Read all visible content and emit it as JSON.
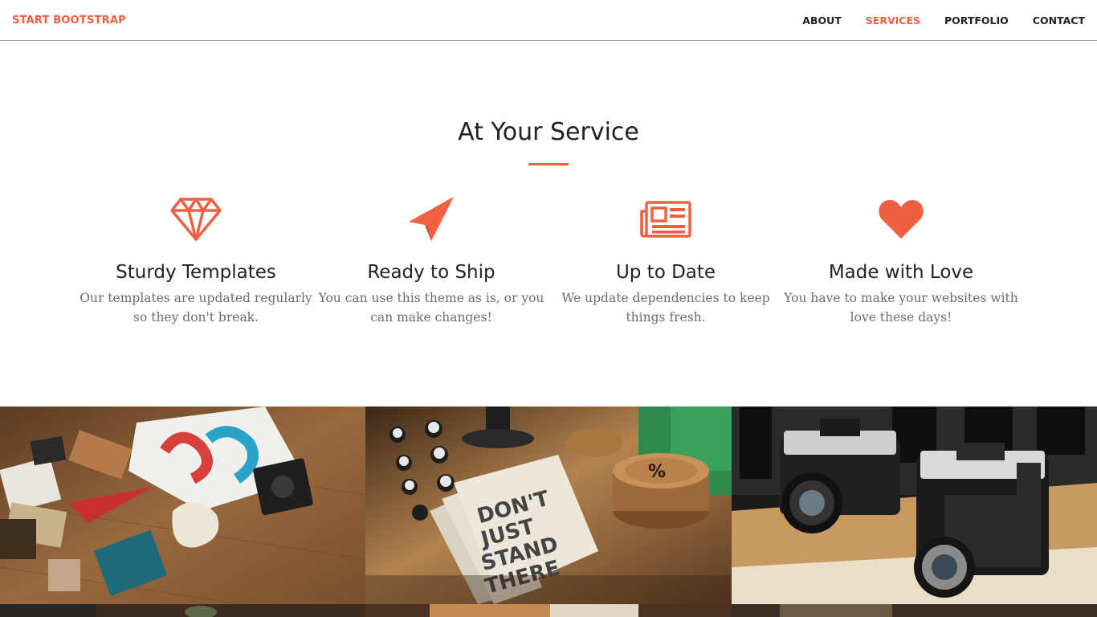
{
  "navbar": {
    "brand": "START BOOTSTRAP",
    "links": [
      {
        "label": "ABOUT",
        "active": false
      },
      {
        "label": "SERVICES",
        "active": true
      },
      {
        "label": "PORTFOLIO",
        "active": false
      },
      {
        "label": "CONTACT",
        "active": false
      }
    ]
  },
  "services": {
    "heading": "At Your Service",
    "items": [
      {
        "icon": "diamond-icon",
        "title": "Sturdy Templates",
        "text": "Our templates are updated regularly so they don't break."
      },
      {
        "icon": "paper-plane-icon",
        "title": "Ready to Ship",
        "text": "You can use this theme as is, or you can make changes!"
      },
      {
        "icon": "newspaper-icon",
        "title": "Up to Date",
        "text": "We update dependencies to keep things fresh."
      },
      {
        "icon": "heart-icon",
        "title": "Made with Love",
        "text": "You have to make your websites with love these days!"
      }
    ]
  },
  "colors": {
    "accent": "#f05f40",
    "text": "#222222",
    "muted": "#6c6c6c"
  }
}
